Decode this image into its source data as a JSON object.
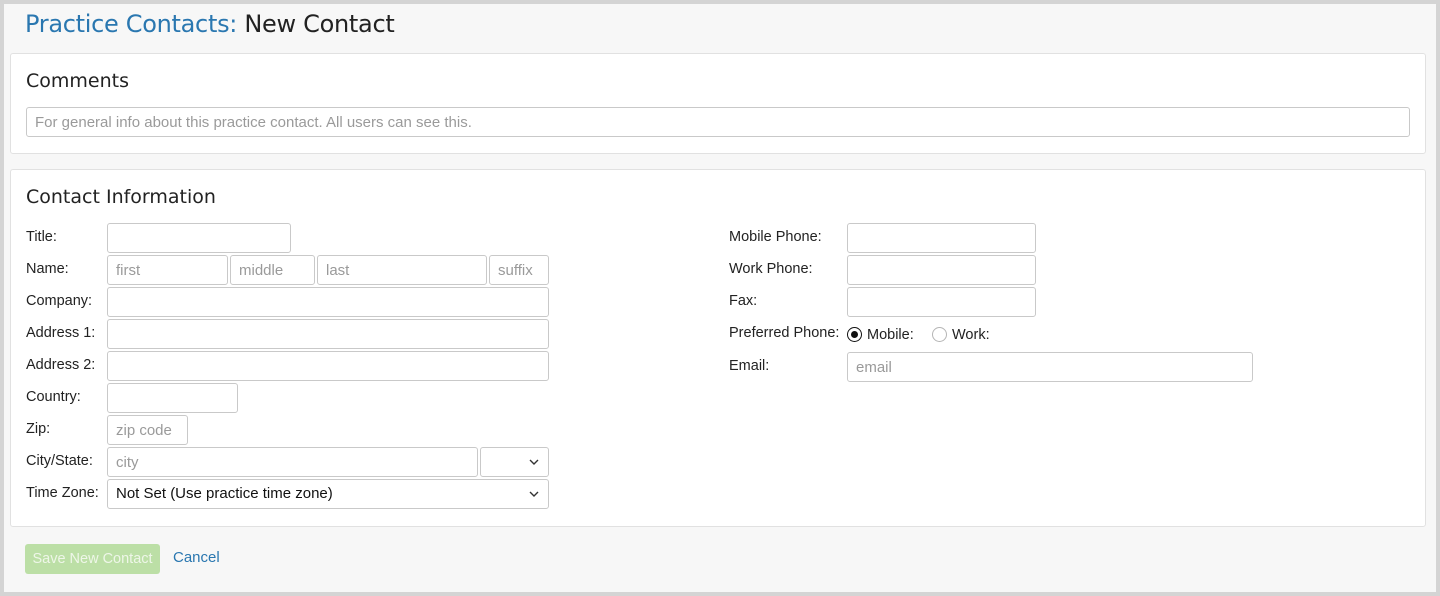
{
  "page": {
    "title_crumb": "Practice Contacts:",
    "title_current": "New Contact"
  },
  "comments": {
    "heading": "Comments",
    "placeholder": "For general info about this practice contact. All users can see this.",
    "value": ""
  },
  "contact": {
    "heading": "Contact Information",
    "title": {
      "label": "Title:",
      "value": ""
    },
    "name": {
      "label": "Name:",
      "first_placeholder": "first",
      "middle_placeholder": "middle",
      "last_placeholder": "last",
      "suffix_placeholder": "suffix"
    },
    "company": {
      "label": "Company:",
      "value": ""
    },
    "address1": {
      "label": "Address 1:",
      "value": ""
    },
    "address2": {
      "label": "Address 2:",
      "value": ""
    },
    "country": {
      "label": "Country:",
      "value": ""
    },
    "zip": {
      "label": "Zip:",
      "placeholder": "zip code"
    },
    "city_state": {
      "label": "City/State:",
      "city_placeholder": "city",
      "state_value": ""
    },
    "time_zone": {
      "label": "Time Zone:",
      "value": "Not Set (Use practice time zone)"
    },
    "mobile_phone": {
      "label": "Mobile Phone:",
      "value": ""
    },
    "work_phone": {
      "label": "Work Phone:",
      "value": ""
    },
    "fax": {
      "label": "Fax:",
      "value": ""
    },
    "preferred_phone": {
      "label": "Preferred Phone:",
      "options": [
        {
          "label": "Mobile:",
          "selected": true
        },
        {
          "label": "Work:",
          "selected": false
        }
      ]
    },
    "email": {
      "label": "Email:",
      "placeholder": "email"
    }
  },
  "actions": {
    "save_label": "Save New Contact",
    "cancel_label": "Cancel"
  },
  "colors": {
    "accent": "#2a77b0",
    "save_disabled_bg": "#bcdfa6"
  }
}
